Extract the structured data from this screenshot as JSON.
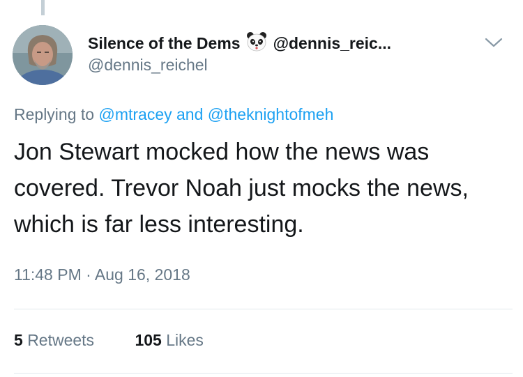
{
  "tweet": {
    "author": {
      "display_name": "Silence of the Dems",
      "name_emoji": "panda-face-icon",
      "handle_header": "@dennis_reic...",
      "handle": "@dennis_reichel"
    },
    "reply": {
      "prefix": "Replying to",
      "user1": "@mtracey",
      "connector": "and",
      "user2": "@theknightofmeh"
    },
    "text": "Jon Stewart mocked how the news was covered. Trevor Noah just mocks the news, which is far less interesting.",
    "timestamp": "11:48 PM · Aug 16, 2018",
    "stats": {
      "retweets_count": "5",
      "retweets_label": "Retweets",
      "likes_count": "105",
      "likes_label": "Likes"
    }
  },
  "icons": {
    "menu": "chevron-down-icon"
  },
  "colors": {
    "text_primary": "#14171a",
    "text_secondary": "#657786",
    "link": "#1da1f2",
    "divider": "#e1e8ed"
  }
}
